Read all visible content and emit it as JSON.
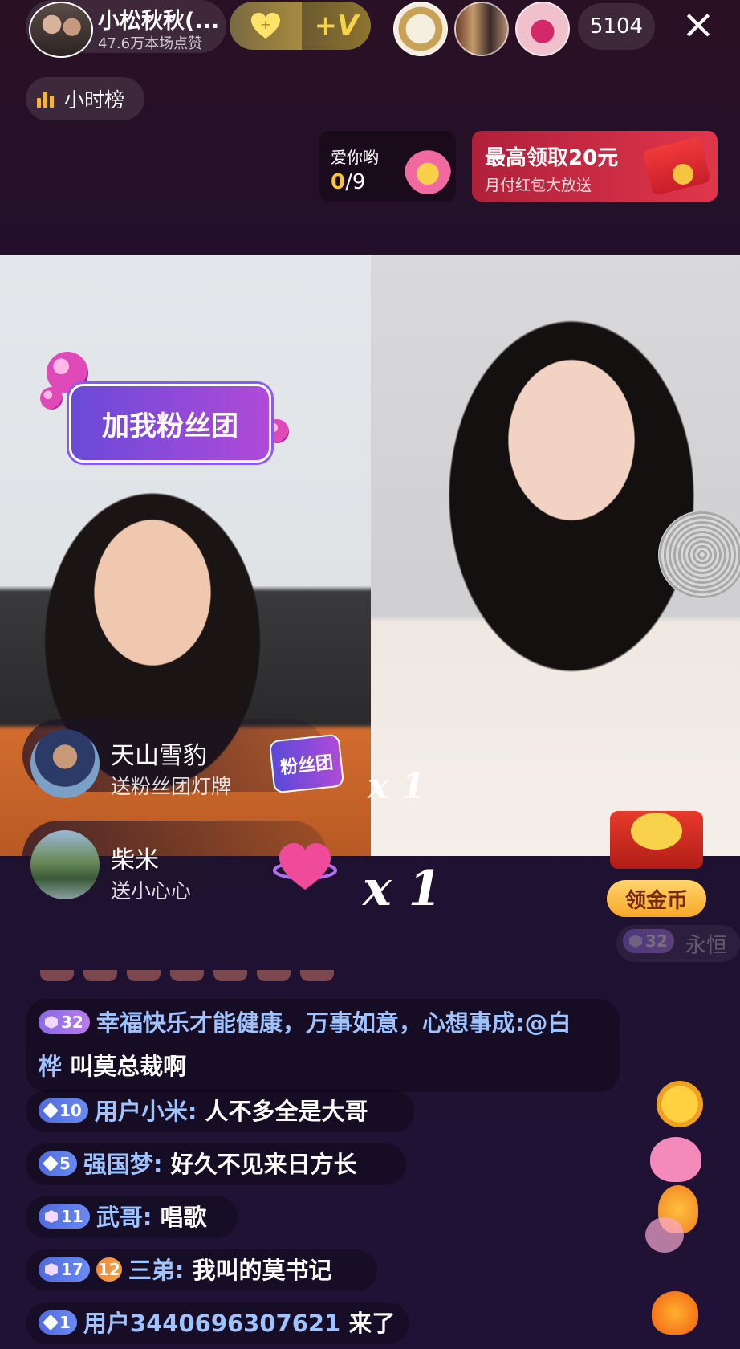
{
  "header": {
    "host_name": "小松秋秋(...",
    "host_likes": "47.6万本场点赞",
    "vip_label": "+V",
    "online_count": "5104",
    "hour_rank_label": "小时榜"
  },
  "task": {
    "title": "爱你哟",
    "current": "0",
    "total": "/9"
  },
  "red_packet": {
    "title": "最高领取20元",
    "subtitle": "月付红包大放送"
  },
  "sticker": {
    "text": "加我粉丝团"
  },
  "gifts": [
    {
      "user": "天山雪豹",
      "action": "送粉丝团灯牌",
      "badge": "粉丝团",
      "combo": "x 1"
    },
    {
      "user": "柴米",
      "action": "送小心心",
      "combo": "x 1"
    }
  ],
  "coins": {
    "label": "领金币"
  },
  "entry_ghost": {
    "level": "32",
    "text": "永恒"
  },
  "chat": [
    {
      "level": "32",
      "user": "幸福快乐才能健康，万事如意，心想事成:",
      "message": "",
      "mention": "@白",
      "cont_user": "桦",
      "cont_msg": " 叫莫总裁啊"
    },
    {
      "level": "10",
      "user": "用户小米:",
      "message": " 人不多全是大哥"
    },
    {
      "level": "5",
      "user": "强国梦:",
      "message": " 好久不见来日方长"
    },
    {
      "level": "11",
      "user": "武哥:",
      "message": " 唱歌"
    },
    {
      "level": "17",
      "fan_level": "12",
      "user": "三弟:",
      "message": " 我叫的莫书记"
    },
    {
      "level": "1",
      "user": "用户3440696307621",
      "message": " 来了"
    }
  ],
  "colors": {
    "chat_user": "#9ec3ff",
    "accent_gold": "#f5d44a",
    "red_packet": "#e0364c"
  }
}
